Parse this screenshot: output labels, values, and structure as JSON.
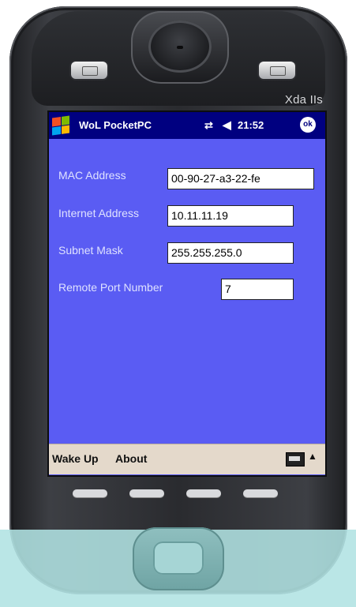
{
  "device": {
    "brand": "Xda IIs",
    "left_button_label": "",
    "right_button_label": ""
  },
  "titlebar": {
    "start_icon": "windows-flag-icon",
    "app_title": "WoL PocketPC",
    "connectivity_icon": "connectivity-icon",
    "volume_icon": "speaker-icon",
    "time": "21:52",
    "ok_label": "ok"
  },
  "form": {
    "mac_label": "MAC Address",
    "mac_value": "00-90-27-a3-22-fe",
    "ip_label": "Internet Address",
    "ip_value": "10.11.11.19",
    "subnet_label": "Subnet Mask",
    "subnet_value": "255.255.255.0",
    "port_label": "Remote Port Number",
    "port_value": "7"
  },
  "menubar": {
    "wake_up": "Wake Up",
    "about": "About",
    "keyboard_icon": "keyboard-icon",
    "arrow_icon": "arrow-up-icon"
  },
  "colors": {
    "screen_bg": "#5a5cf3",
    "titlebar_bg": "#000080",
    "menubar_bg": "#e4d9cb",
    "bottom_overlay": "#b0e2e2"
  }
}
